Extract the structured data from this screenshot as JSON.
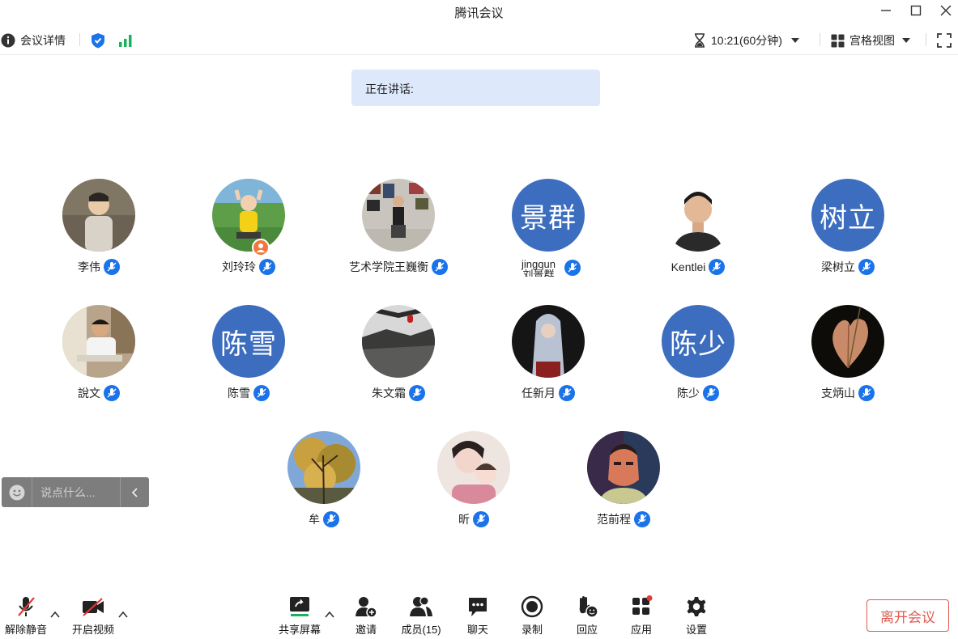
{
  "window": {
    "title": "腾讯会议"
  },
  "infobar": {
    "details_label": "会议详情",
    "timer_label": "10:21(60分钟)",
    "view_label": "宫格视图"
  },
  "speaking": {
    "label": "正在讲话:"
  },
  "participants": [
    {
      "name": "李伟"
    },
    {
      "name": "刘玲玲"
    },
    {
      "name": "艺术学院王巍衡"
    },
    {
      "name": "jingqun 刘景群",
      "initials": "景群"
    },
    {
      "name": "Kentlei"
    },
    {
      "name": "梁树立",
      "initials": "树立"
    },
    {
      "name": "說文"
    },
    {
      "name": "陈雪",
      "initials": "陈雪"
    },
    {
      "name": "朱文霜"
    },
    {
      "name": "任新月"
    },
    {
      "name": "陈少",
      "initials": "陈少"
    },
    {
      "name": "支炳山"
    },
    {
      "name": "牟"
    },
    {
      "name": "昕"
    },
    {
      "name": "范前程"
    }
  ],
  "chat": {
    "placeholder": "说点什么..."
  },
  "toolbar": {
    "unmute": "解除静音",
    "video": "开启视频",
    "share": "共享屏幕",
    "invite": "邀请",
    "members": "成员(15)",
    "chat": "聊天",
    "record": "录制",
    "react": "回应",
    "apps": "应用",
    "settings": "设置",
    "leave": "离开会议"
  },
  "colors": {
    "accent": "#1a73e8",
    "avatar_bg": "#3d6dbf",
    "speaking_bg": "#dde9fb",
    "leave": "#e05a50",
    "share_green": "#19b35c"
  }
}
